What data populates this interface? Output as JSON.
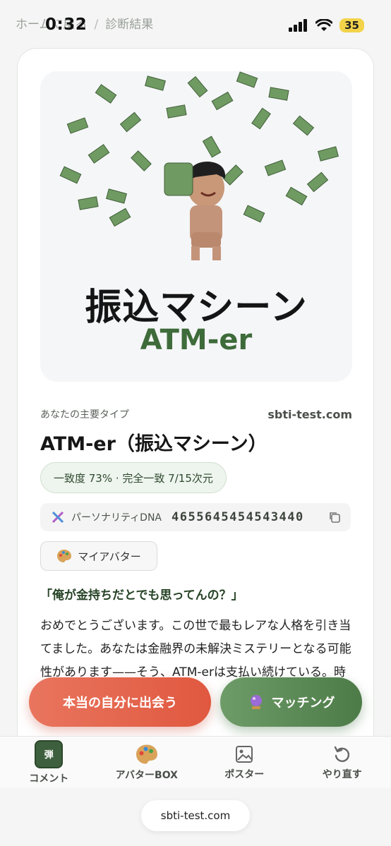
{
  "status_bar": {
    "time": "0:32",
    "battery": "35"
  },
  "breadcrumb": {
    "home": "ホームに戻る",
    "separator": "/",
    "current": "診断結果"
  },
  "hero": {
    "title": "振込マシーン",
    "subtitle": "ATM-er"
  },
  "result": {
    "label": "あなたの主要タイプ",
    "site": "sbti-test.com",
    "type_title": "ATM-er（振込マシーン）",
    "match": "一致度 73% · 完全一致 7/15次元",
    "dna_label": "パーソナリティDNA",
    "dna_code": "4655645454543440",
    "avatar_button": "マイアバター",
    "quote": "「俺が金持ちだとでも思ってんの？」",
    "body": "おめでとうございます。この世で最もレアな人格を引き当てました。あなたは金融界の未解決ミステリーとなる可能性があります——そう、ATM-erは支払い続けている。時間を支払い、体力を支払い、忍"
  },
  "cta": {
    "left": "本当の自分に出会う",
    "right": "マッチング"
  },
  "tabs": [
    {
      "label": "コメント",
      "icon_text": "弾"
    },
    {
      "label": "アバターBOX"
    },
    {
      "label": "ポスター"
    },
    {
      "label": "やり直す"
    }
  ],
  "url": "sbti-test.com",
  "colors": {
    "accent_green": "#3e6b3a",
    "cta_red": "#e0583f",
    "cta_green": "#4d7b48"
  },
  "icons": [
    "wifi-icon",
    "signal-icon",
    "dna-icon",
    "copy-icon",
    "palette-icon",
    "crystal-ball-icon",
    "image-icon",
    "refresh-icon"
  ]
}
